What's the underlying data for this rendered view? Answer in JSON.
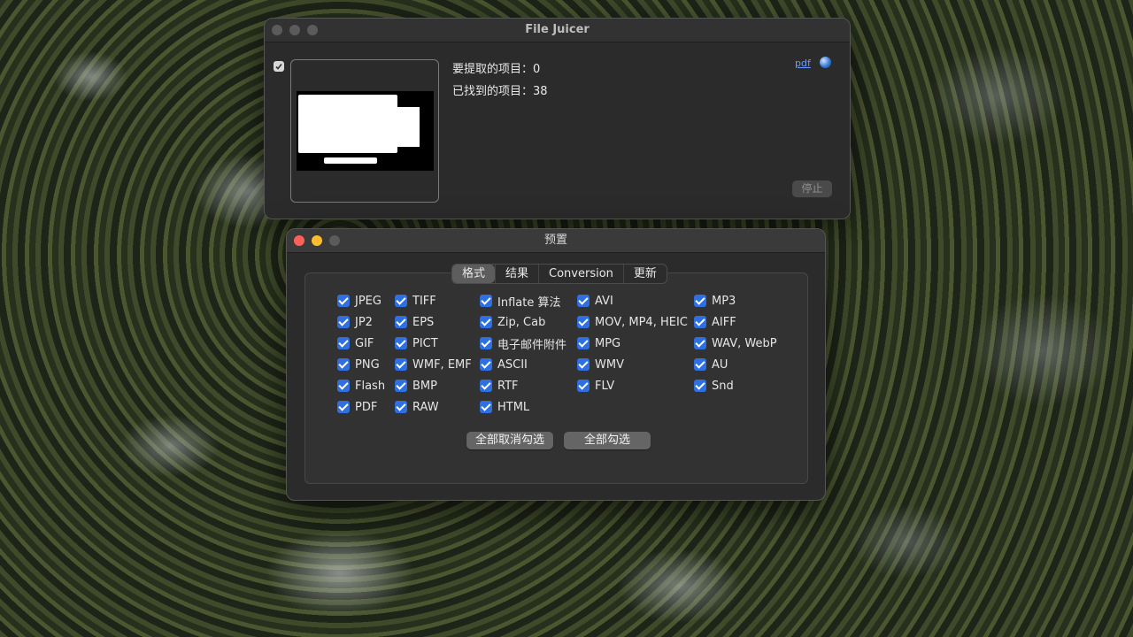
{
  "file_juicer": {
    "title": "File Juicer",
    "items_to_extract_label": "要提取的项目：0",
    "items_found_label": "已找到的项目：38",
    "pdf_label": "pdf",
    "stop_label": "停止"
  },
  "preferences": {
    "title": "预置",
    "tabs": [
      "格式",
      "结果",
      "Conversion",
      "更新"
    ],
    "active_tab": "格式",
    "formats": {
      "col1": [
        "JPEG",
        "JP2",
        "GIF",
        "PNG",
        "Flash",
        "PDF"
      ],
      "col2": [
        "TIFF",
        "EPS",
        "PICT",
        "WMF, EMF",
        "BMP",
        "RAW"
      ],
      "col3": [
        "Inflate 算法",
        "Zip, Cab",
        "电子邮件附件",
        "ASCII",
        "RTF",
        "HTML"
      ],
      "col4": [
        "AVI",
        "MOV, MP4, HEIC",
        "MPG",
        "WMV",
        "FLV"
      ],
      "col5": [
        "MP3",
        "AIFF",
        "WAV, WebP",
        "AU",
        "Snd"
      ]
    },
    "deselect_all_label": "全部取消勾选",
    "select_all_label": "全部勾选"
  },
  "colors": {
    "checkbox": "#2f6fe0",
    "window_bg": "#2b2b2b"
  }
}
